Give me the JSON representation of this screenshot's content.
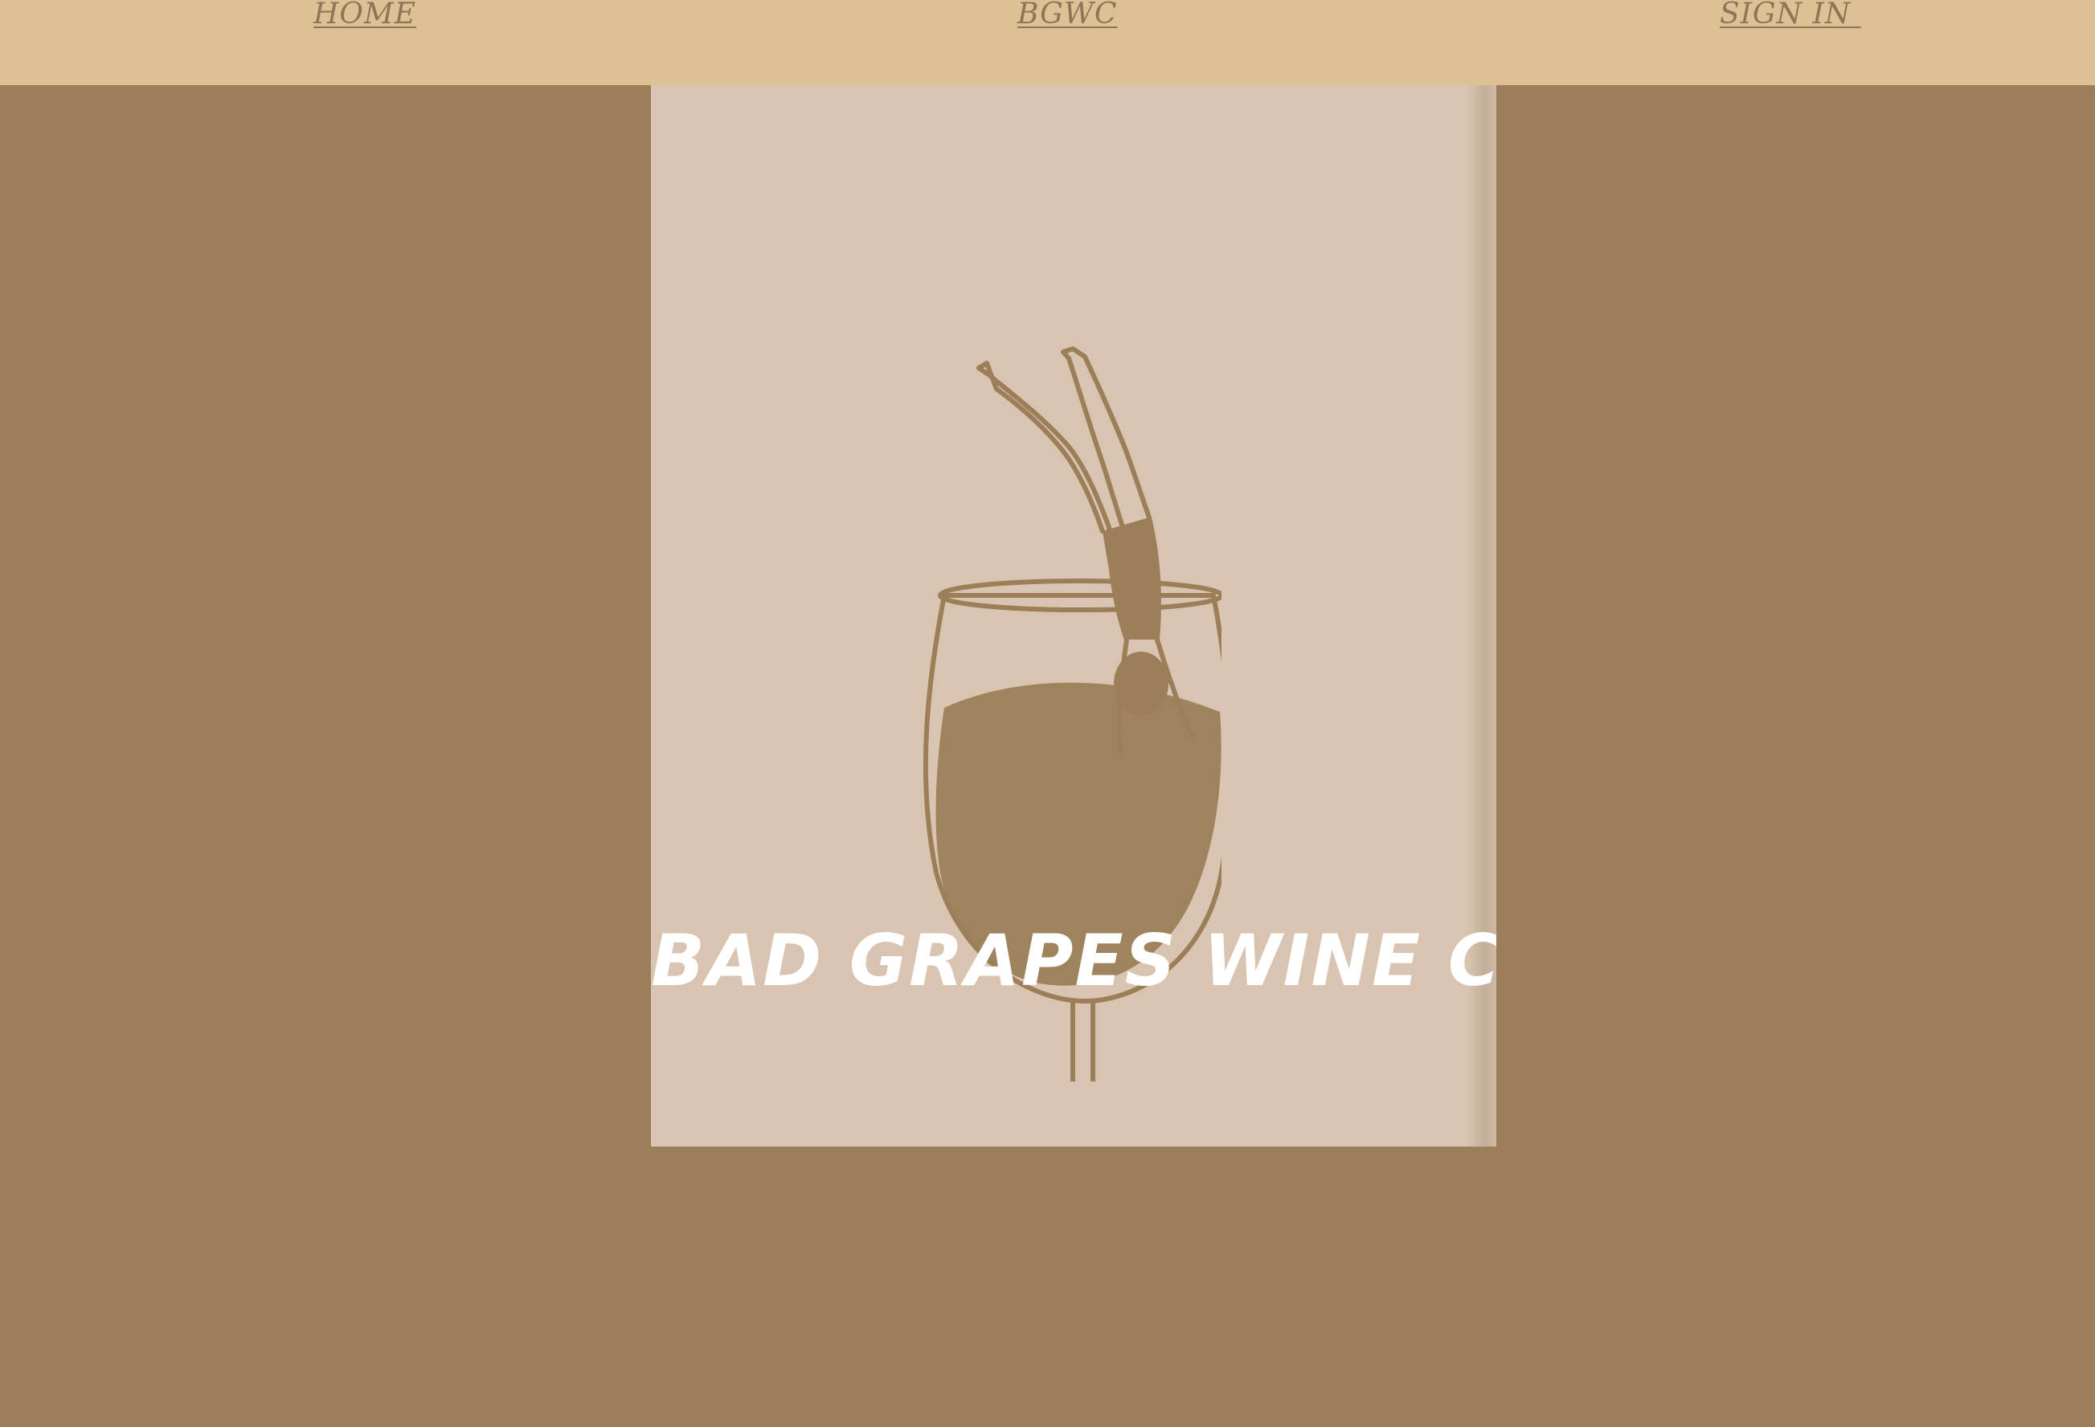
{
  "nav": {
    "home_label": "HOME",
    "brand_label": "BGWC",
    "signin_label": "SIGN IN "
  },
  "hero": {
    "title": "BAD GRAPES WINE CLUB",
    "illustration_icon": "diver-into-wine-glass-icon"
  },
  "colors": {
    "background": "#9c7f58",
    "nav_background": "#dec095",
    "nav_text": "#8c7657",
    "hero_background": "#d8c4b1",
    "illustration": "#9c7f58",
    "title_text": "#ffffff"
  }
}
